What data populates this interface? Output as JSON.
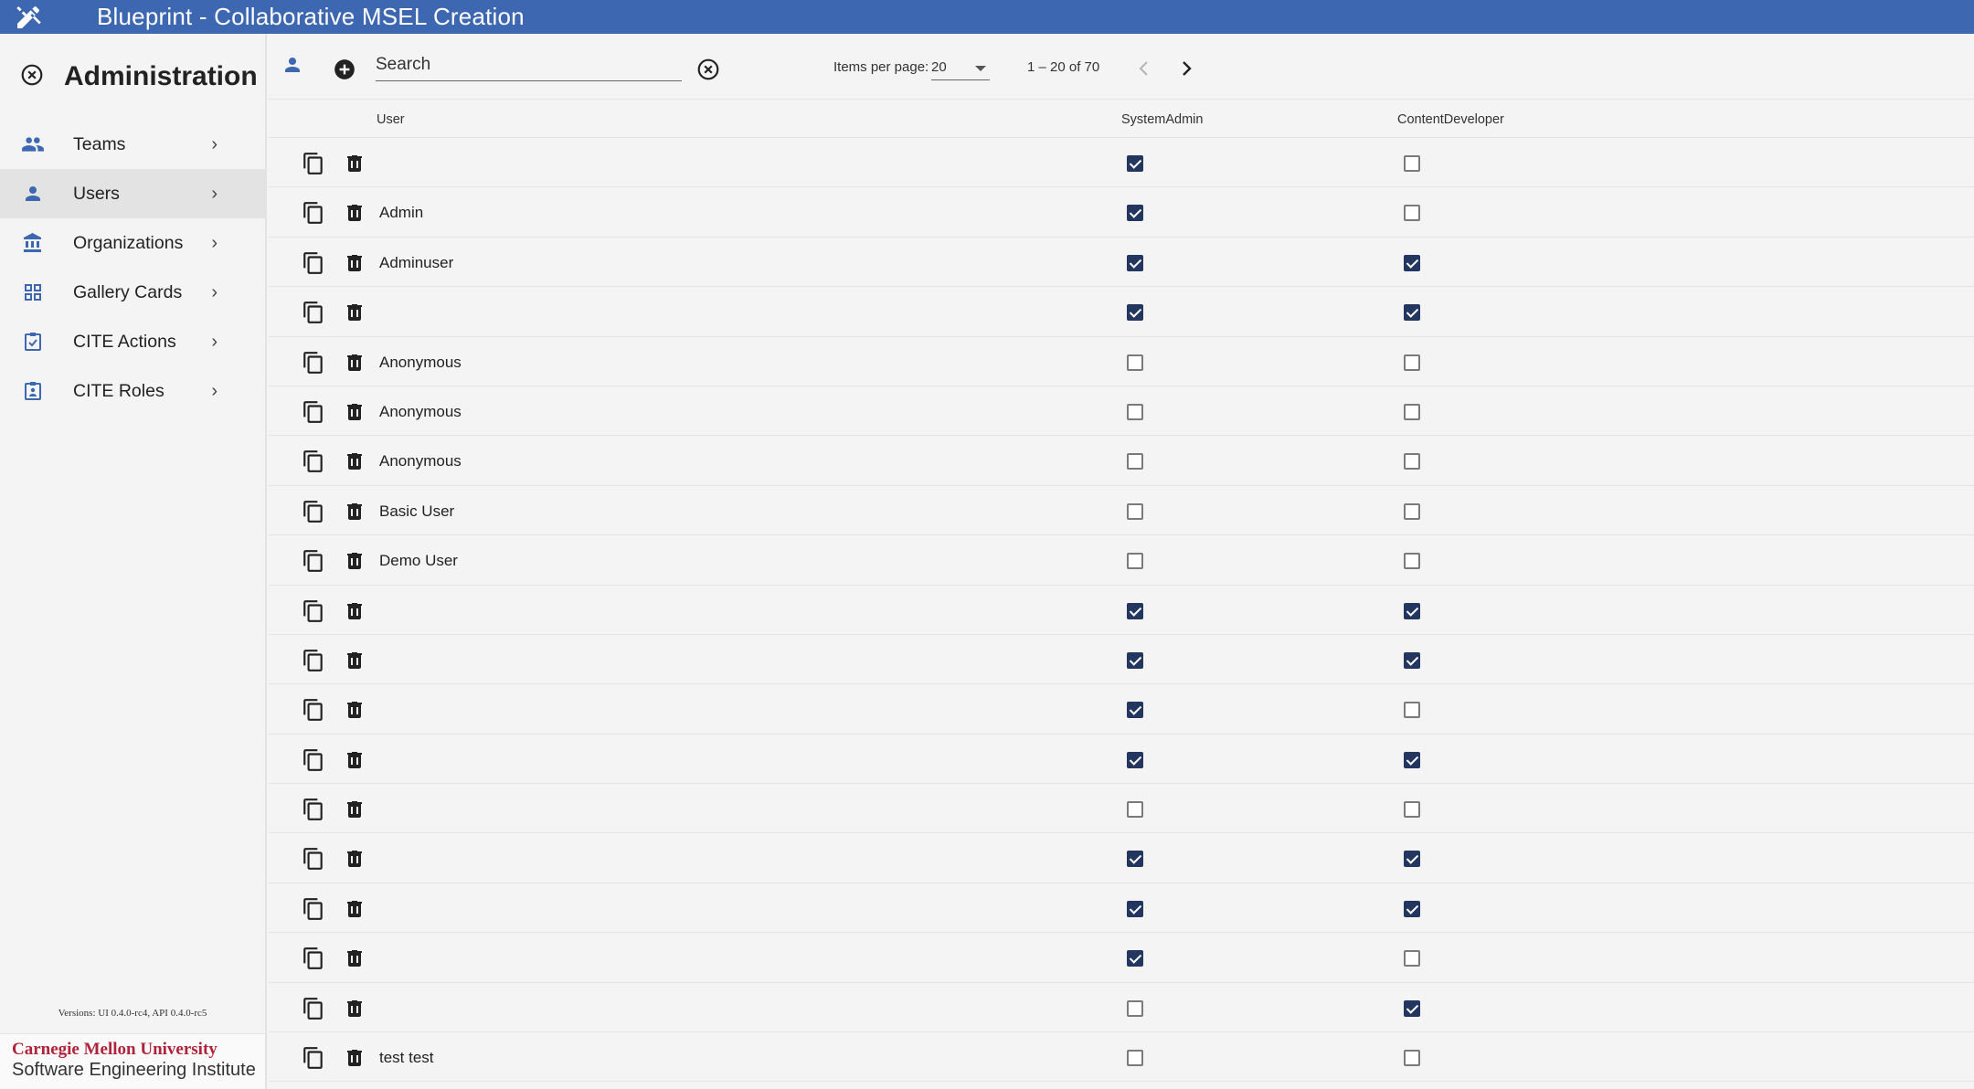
{
  "app": {
    "title": "Blueprint - Collaborative MSEL Creation"
  },
  "sidebar": {
    "title": "Administration",
    "items": [
      {
        "label": "Teams",
        "icon": "group-icon"
      },
      {
        "label": "Users",
        "icon": "person-icon",
        "active": true
      },
      {
        "label": "Organizations",
        "icon": "bank-icon"
      },
      {
        "label": "Gallery Cards",
        "icon": "grid-icon"
      },
      {
        "label": "CITE Actions",
        "icon": "assignment-check-icon"
      },
      {
        "label": "CITE Roles",
        "icon": "assignment-ind-icon"
      }
    ],
    "versions": "Versions: UI 0.4.0-rc4, API 0.4.0-rc5",
    "footer_line1": "Carnegie Mellon University",
    "footer_line2": "Software Engineering Institute"
  },
  "toolbar": {
    "search_placeholder": "Search",
    "items_per_page_label": "Items per page:",
    "items_per_page_value": "20",
    "range_label": "1 – 20 of 70"
  },
  "table": {
    "columns": {
      "user": "User",
      "system_admin": "SystemAdmin",
      "content_developer": "ContentDeveloper"
    },
    "rows": [
      {
        "user": "",
        "system_admin": true,
        "content_developer": false
      },
      {
        "user": "Admin",
        "system_admin": true,
        "content_developer": false
      },
      {
        "user": "Adminuser",
        "system_admin": true,
        "content_developer": true
      },
      {
        "user": "",
        "system_admin": true,
        "content_developer": true
      },
      {
        "user": "Anonymous",
        "system_admin": false,
        "content_developer": false
      },
      {
        "user": "Anonymous",
        "system_admin": false,
        "content_developer": false
      },
      {
        "user": "Anonymous",
        "system_admin": false,
        "content_developer": false
      },
      {
        "user": "Basic User",
        "system_admin": false,
        "content_developer": false
      },
      {
        "user": "Demo User",
        "system_admin": false,
        "content_developer": false
      },
      {
        "user": "",
        "system_admin": true,
        "content_developer": true
      },
      {
        "user": "",
        "system_admin": true,
        "content_developer": true
      },
      {
        "user": "",
        "system_admin": true,
        "content_developer": false
      },
      {
        "user": "",
        "system_admin": true,
        "content_developer": true
      },
      {
        "user": "",
        "system_admin": false,
        "content_developer": false
      },
      {
        "user": "",
        "system_admin": true,
        "content_developer": true
      },
      {
        "user": "",
        "system_admin": true,
        "content_developer": true
      },
      {
        "user": "",
        "system_admin": true,
        "content_developer": false
      },
      {
        "user": "",
        "system_admin": false,
        "content_developer": true
      },
      {
        "user": "test test",
        "system_admin": false,
        "content_developer": false
      }
    ]
  },
  "colors": {
    "brand": "#3d67b1",
    "checkbox_checked": "#22365f",
    "icon_blue": "#3d67b1"
  }
}
